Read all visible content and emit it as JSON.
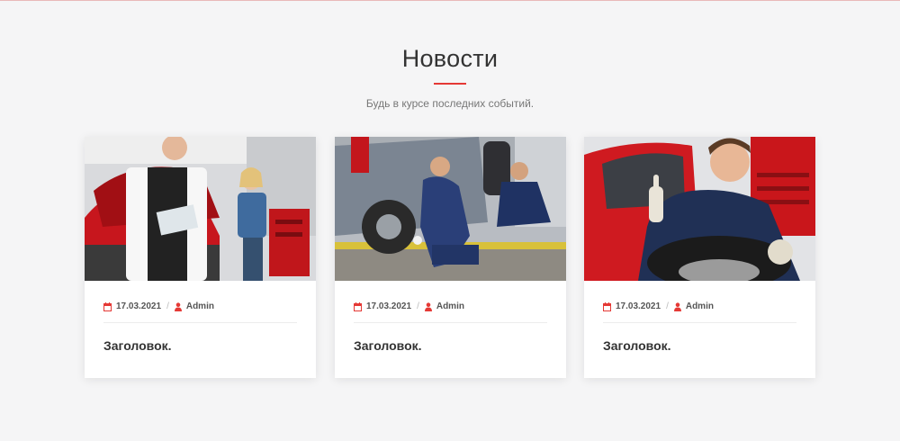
{
  "section": {
    "title": "Новости",
    "subtitle": "Будь в курсе последних событий."
  },
  "colors": {
    "accent": "#e53935",
    "background": "#f5f5f6",
    "card": "#ffffff",
    "text": "#333333"
  },
  "icons": {
    "date": "calendar-icon",
    "author": "user-icon"
  },
  "news": [
    {
      "date": "17.03.2021",
      "author": "Admin",
      "title": "Заголовок.",
      "image": "mechanic-with-clipboard-and-client-photo"
    },
    {
      "date": "17.03.2021",
      "author": "Admin",
      "title": "Заголовок.",
      "image": "mechanics-changing-tire-photo"
    },
    {
      "date": "17.03.2021",
      "author": "Admin",
      "title": "Заголовок.",
      "image": "mechanic-holding-tire-photo"
    }
  ]
}
